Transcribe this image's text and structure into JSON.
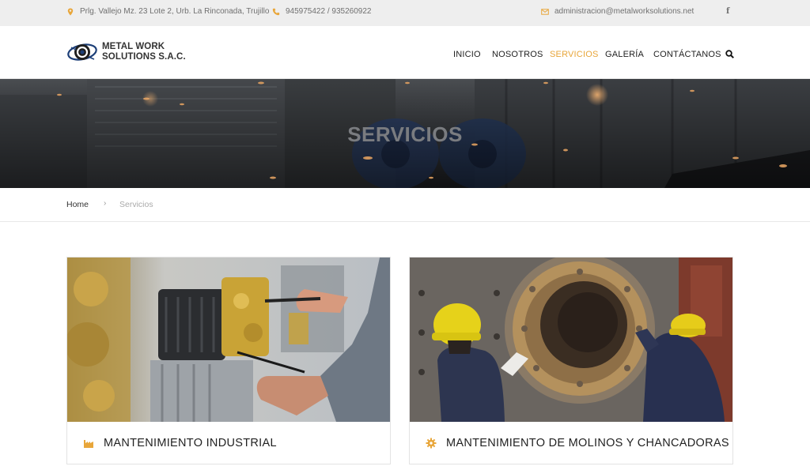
{
  "topbar": {
    "address": "Prlg. Vallejo Mz. 23 Lote 2, Urb. La Rinconada, Trujillo",
    "phone": "945975422 / 935260922",
    "email": "administracion@metalworksolutions.net",
    "social_icon": "facebook-icon",
    "accent_color": "#e8a63a"
  },
  "header": {
    "logo_line1": "METAL WORK",
    "logo_line2": "SOLUTIONS S.A.C.",
    "nav": [
      "INICIO",
      "NOSOTROS",
      "SERVICIOS",
      "GALERÍA",
      "CONTÁCTANOS"
    ],
    "active_nav": "SERVICIOS",
    "search_icon": "search-icon"
  },
  "hero": {
    "title": "SERVICIOS"
  },
  "breadcrumb": {
    "home": "Home",
    "separator": "›",
    "current": "Servicios"
  },
  "cards": [
    {
      "title": "MANTENIMIENTO INDUSTRIAL",
      "icon": "factory-icon"
    },
    {
      "title": "MANTENIMIENTO DE MOLINOS Y CHANCADORAS",
      "icon": "gear-icon"
    }
  ]
}
